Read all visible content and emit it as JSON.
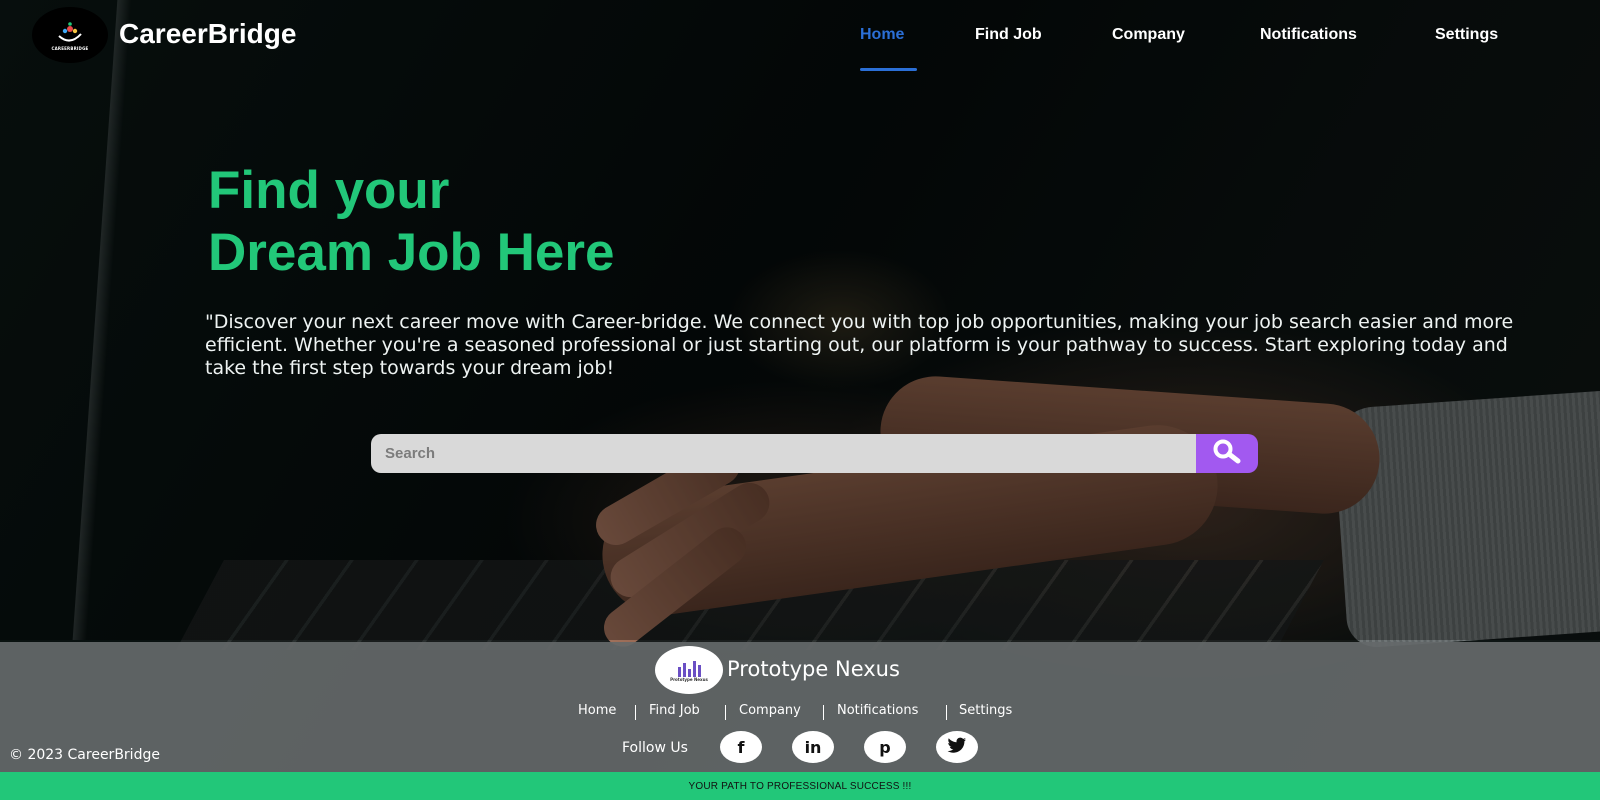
{
  "header": {
    "logo_text": "CAREERBRIDGE",
    "brand": "CareerBridge",
    "nav": [
      {
        "label": "Home",
        "active": true
      },
      {
        "label": "Find Job",
        "active": false
      },
      {
        "label": "Company",
        "active": false
      },
      {
        "label": "Notifications",
        "active": false
      },
      {
        "label": "Settings",
        "active": false
      }
    ]
  },
  "hero": {
    "title_line1": "Find your",
    "title_line2": "Dream Job Here",
    "description": "\"Discover your next career move with Career-bridge. We connect you with top job opportunities, making your job search easier and more efficient. Whether you're a seasoned professional or just starting out, our platform is your pathway to success. Start exploring today and take the first step towards your dream job!"
  },
  "search": {
    "placeholder": "Search",
    "value": "",
    "icon": "search-icon"
  },
  "footer": {
    "logo_text": "Prototype Nexus",
    "brand": "Prototype Nexus",
    "links": [
      "Home",
      "Find Job",
      "Company",
      "Notifications",
      "Settings"
    ],
    "follow_label": "Follow Us",
    "social": [
      {
        "name": "facebook",
        "glyph": "f"
      },
      {
        "name": "linkedin",
        "glyph": "in"
      },
      {
        "name": "pinterest",
        "glyph": "p"
      },
      {
        "name": "twitter",
        "glyph": "t"
      }
    ],
    "copyright": "© 2023 CareerBridge",
    "tagline": "YOUR PATH TO PROFESSIONAL SUCCESS !!!"
  },
  "colors": {
    "accent_green": "#22c779",
    "active_nav": "#2b6fd6",
    "search_button": "#a259f0",
    "footer_bg": "#646869"
  }
}
